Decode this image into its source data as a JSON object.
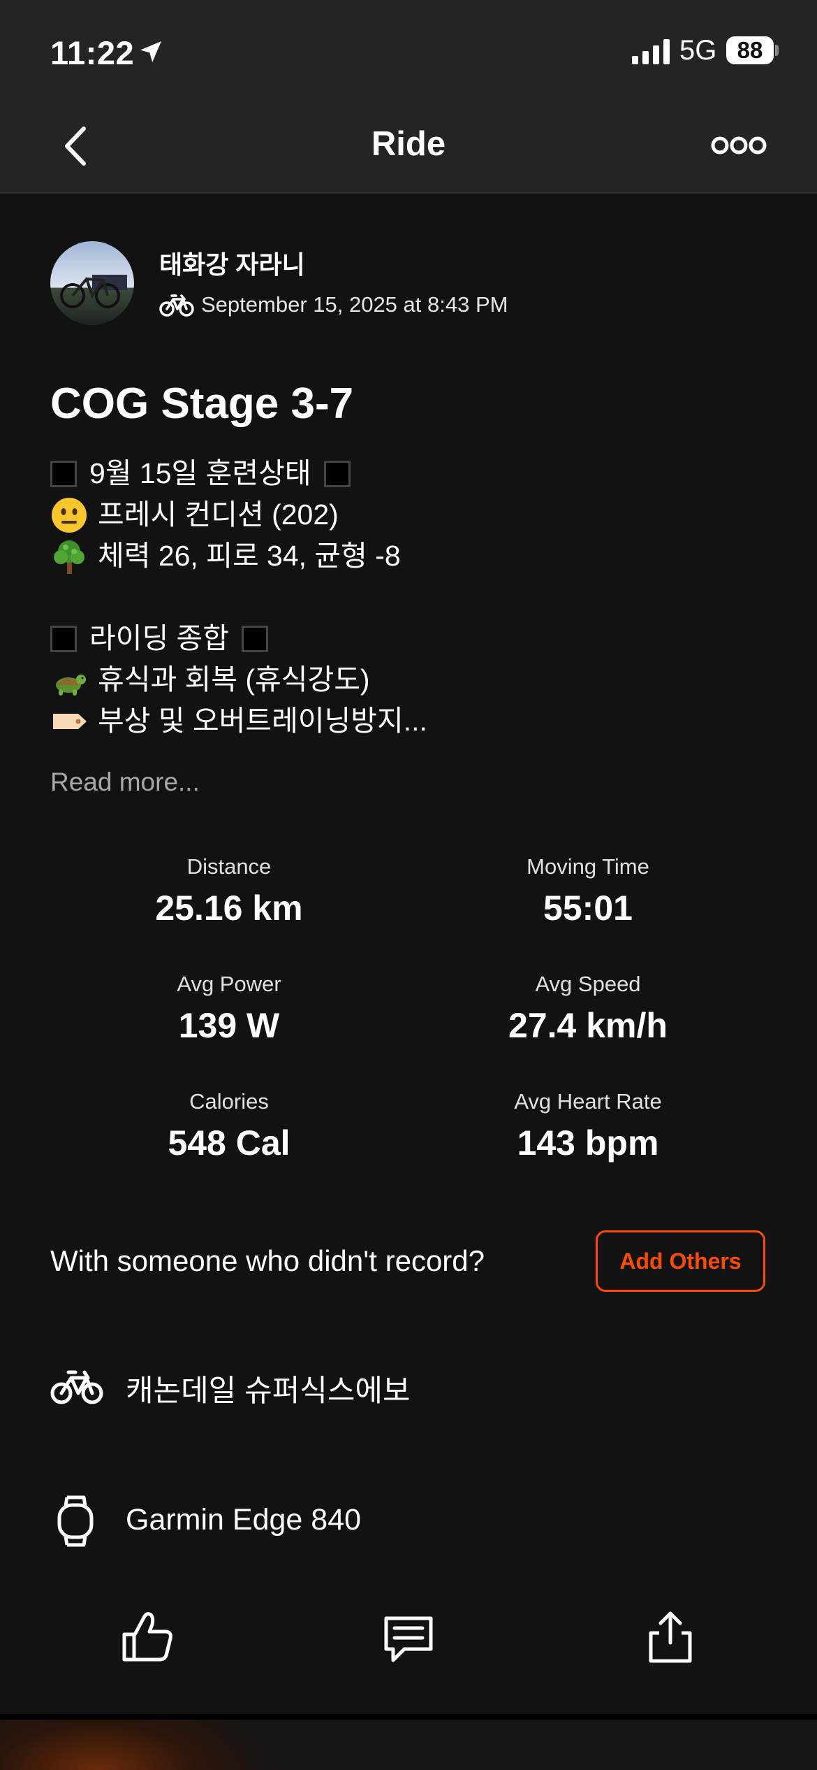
{
  "status_bar": {
    "time": "11:22",
    "network": "5G",
    "battery": "88"
  },
  "nav": {
    "title": "Ride"
  },
  "athlete": {
    "name": "태화강 자라니",
    "date": "September 15, 2025 at 8:43 PM"
  },
  "activity": {
    "title": "COG Stage 3-7",
    "description": [
      {
        "type": "header",
        "text": "9월 15일 훈련상태"
      },
      {
        "type": "emoji",
        "icon": "neutral-face-emoji",
        "text": "프레시 컨디션 (202)"
      },
      {
        "type": "emoji",
        "icon": "tree-emoji",
        "text": "체력 26, 피로 34, 균형 -8"
      },
      {
        "type": "blank",
        "text": ""
      },
      {
        "type": "header",
        "text": "라이딩 종합"
      },
      {
        "type": "emoji",
        "icon": "turtle-emoji",
        "text": "휴식과 회복 (휴식강도)"
      },
      {
        "type": "emoji",
        "icon": "label-tag-emoji",
        "text": "부상 및 오버트레이닝방지..."
      }
    ],
    "read_more": "Read more..."
  },
  "stats": [
    {
      "label": "Distance",
      "value": "25.16 km"
    },
    {
      "label": "Moving Time",
      "value": "55:01"
    },
    {
      "label": "Avg Power",
      "value": "139 W"
    },
    {
      "label": "Avg Speed",
      "value": "27.4 km/h"
    },
    {
      "label": "Calories",
      "value": "548 Cal"
    },
    {
      "label": "Avg Heart Rate",
      "value": "143 bpm"
    }
  ],
  "add_others": {
    "prompt": "With someone who didn't record?",
    "button": "Add Others"
  },
  "gear": {
    "bike": "캐논데일 슈퍼식스에보",
    "device": "Garmin Edge 840"
  },
  "colors": {
    "accent": "#fc4c02",
    "background": "#121212",
    "header": "#242424"
  }
}
